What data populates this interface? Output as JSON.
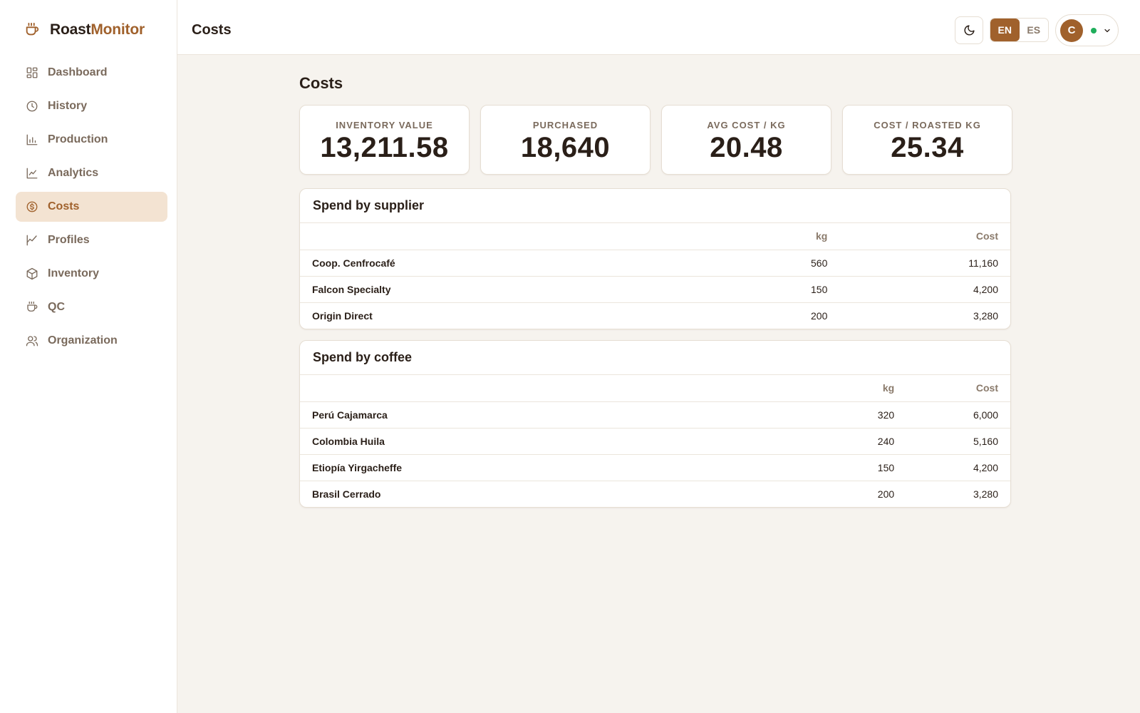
{
  "app": {
    "name_part1": "Roast",
    "name_part2": "Monitor"
  },
  "sidebar": {
    "items": [
      {
        "label": "Dashboard",
        "icon": "dashboard-grid-icon"
      },
      {
        "label": "History",
        "icon": "clock-icon"
      },
      {
        "label": "Production",
        "icon": "bar-chart-icon"
      },
      {
        "label": "Analytics",
        "icon": "line-chart-icon"
      },
      {
        "label": "Costs",
        "icon": "dollar-circle-icon",
        "active": true
      },
      {
        "label": "Profiles",
        "icon": "trend-line-icon"
      },
      {
        "label": "Inventory",
        "icon": "box-icon"
      },
      {
        "label": "QC",
        "icon": "coffee-cup-icon"
      },
      {
        "label": "Organization",
        "icon": "users-icon"
      }
    ]
  },
  "header": {
    "title": "Costs",
    "lang_options": [
      "EN",
      "ES"
    ],
    "lang_selected": "EN",
    "user_initial": "C"
  },
  "main": {
    "title": "Costs",
    "stats": [
      {
        "label": "INVENTORY VALUE",
        "value": "13,211.58"
      },
      {
        "label": "PURCHASED",
        "value": "18,640"
      },
      {
        "label": "AVG COST / KG",
        "value": "20.48"
      },
      {
        "label": "COST / ROASTED KG",
        "value": "25.34"
      }
    ],
    "supplier_table": {
      "title": "Spend by supplier",
      "columns": [
        "",
        "kg",
        "Cost"
      ],
      "rows": [
        {
          "name": "Coop. Cenfrocafé",
          "kg": "560",
          "cost": "11,160"
        },
        {
          "name": "Falcon Specialty",
          "kg": "150",
          "cost": "4,200"
        },
        {
          "name": "Origin Direct",
          "kg": "200",
          "cost": "3,280"
        }
      ]
    },
    "coffee_table": {
      "title": "Spend by coffee",
      "columns": [
        "",
        "kg",
        "Cost"
      ],
      "rows": [
        {
          "name": "Perú Cajamarca",
          "kg": "320",
          "cost": "6,000"
        },
        {
          "name": "Colombia Huila",
          "kg": "240",
          "cost": "5,160"
        },
        {
          "name": "Etiopía Yirgacheffe",
          "kg": "150",
          "cost": "4,200"
        },
        {
          "name": "Brasil Cerrado",
          "kg": "200",
          "cost": "3,280"
        }
      ]
    }
  },
  "colors": {
    "accent": "#a0612c",
    "accent_soft": "#f3e3d2",
    "background": "#f6f3ee",
    "status_online": "#1fae5b"
  }
}
